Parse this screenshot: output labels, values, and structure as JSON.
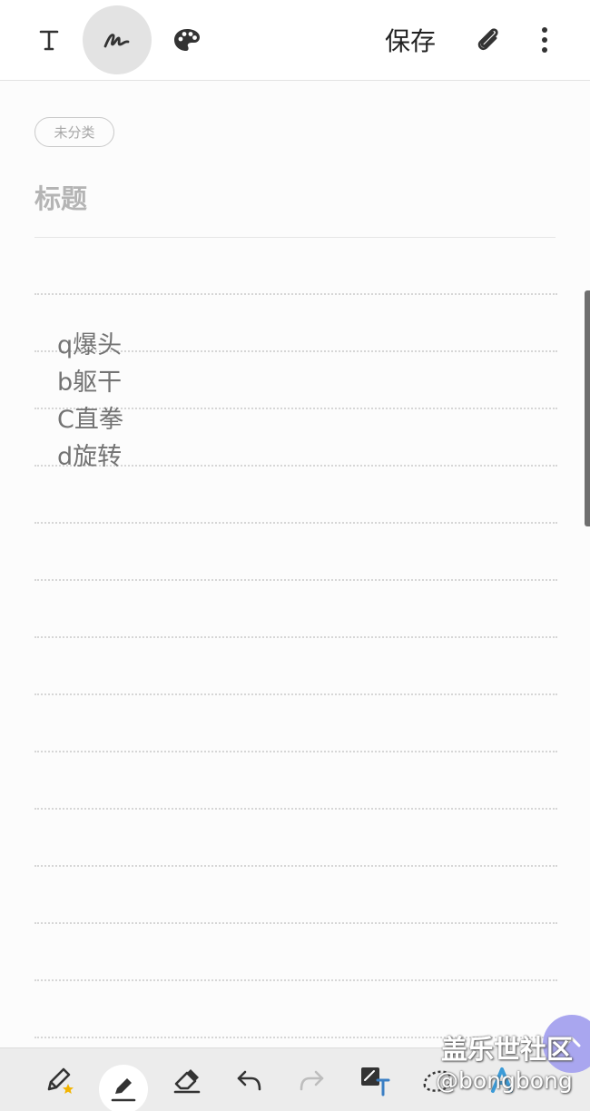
{
  "toolbar": {
    "modes": [
      {
        "name": "text-mode",
        "icon": "text-icon"
      },
      {
        "name": "handwriting-mode",
        "icon": "handwriting-pen-icon",
        "active": true
      },
      {
        "name": "drawing-mode",
        "icon": "palette-icon"
      }
    ],
    "save_label": "保存",
    "attach_icon": "paperclip-icon",
    "more_icon": "more-vertical-icon"
  },
  "note": {
    "category": "未分类",
    "title_placeholder": "标题",
    "lines": [
      "q爆头",
      "b躯干",
      "C直拳",
      "d旋转"
    ]
  },
  "bottom_toolbar": {
    "tools": [
      {
        "name": "favorite-pen",
        "icon": "pen-star-icon"
      },
      {
        "name": "pen",
        "icon": "pen-icon",
        "active": true
      },
      {
        "name": "eraser",
        "icon": "eraser-icon"
      },
      {
        "name": "undo",
        "icon": "undo-icon"
      },
      {
        "name": "redo",
        "icon": "redo-icon",
        "disabled": true
      },
      {
        "name": "convert-to-text",
        "icon": "convert-text-icon"
      },
      {
        "name": "selection",
        "icon": "lasso-select-icon"
      },
      {
        "name": "text-style",
        "icon": "text-style-icon"
      }
    ]
  },
  "watermark": {
    "title": "盖乐世社区",
    "handle": "@bongbong"
  },
  "colors": {
    "accent": "#3b7fc4",
    "fab": "#a9a6ef",
    "star": "#f2b400"
  }
}
